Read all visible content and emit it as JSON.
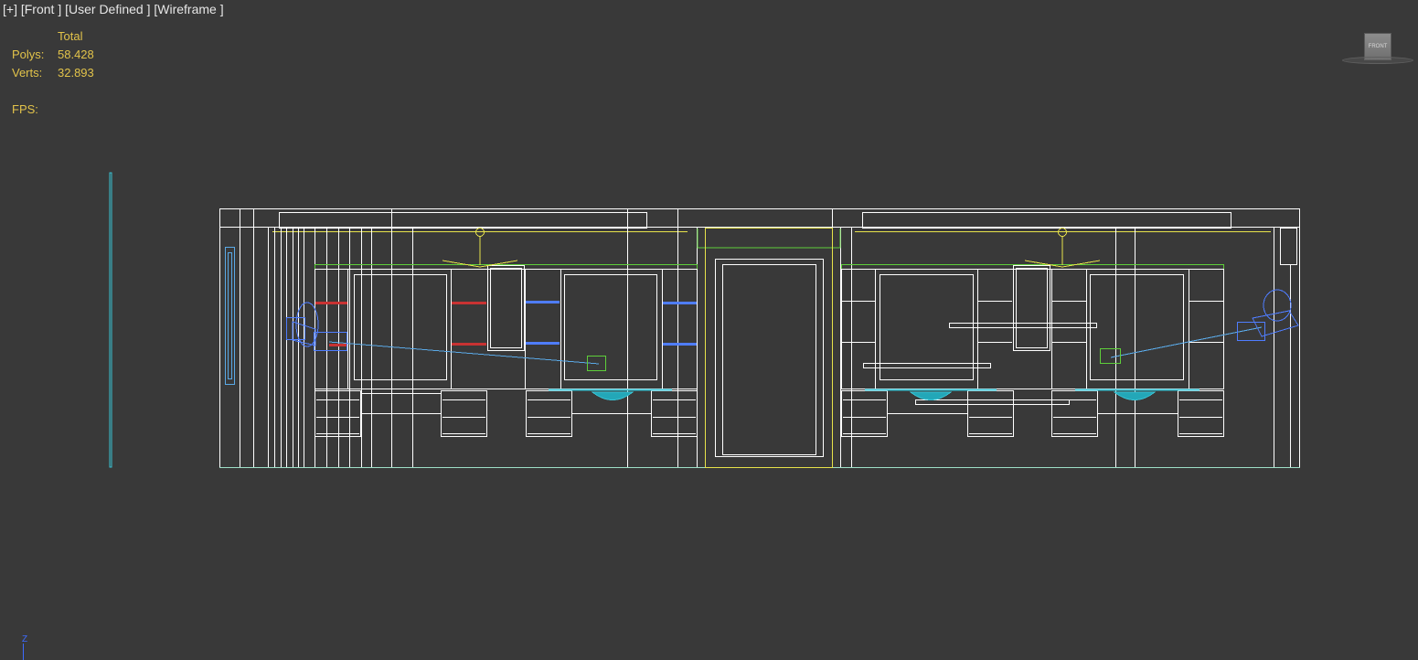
{
  "viewport": {
    "labels": [
      "[+]",
      "[Front ]",
      "[User Defined ]",
      "[Wireframe ]"
    ]
  },
  "stats": {
    "header": "Total",
    "polys_label": "Polys:",
    "polys_value": "58.428",
    "verts_label": "Verts:",
    "verts_value": "32.893",
    "fps_label": "FPS:"
  },
  "viewcube": {
    "face_label": "FRONT"
  },
  "axis": {
    "label": "Z"
  },
  "colors": {
    "background": "#393939",
    "wire": "#ffffff",
    "green": "#5ecf3a",
    "yellow": "#e7e24a",
    "blue": "#4f7dff",
    "cyan": "#39c2d3",
    "red": "#c83232",
    "lightblue": "#5aa9e6",
    "stats_text": "#e2c34a"
  }
}
